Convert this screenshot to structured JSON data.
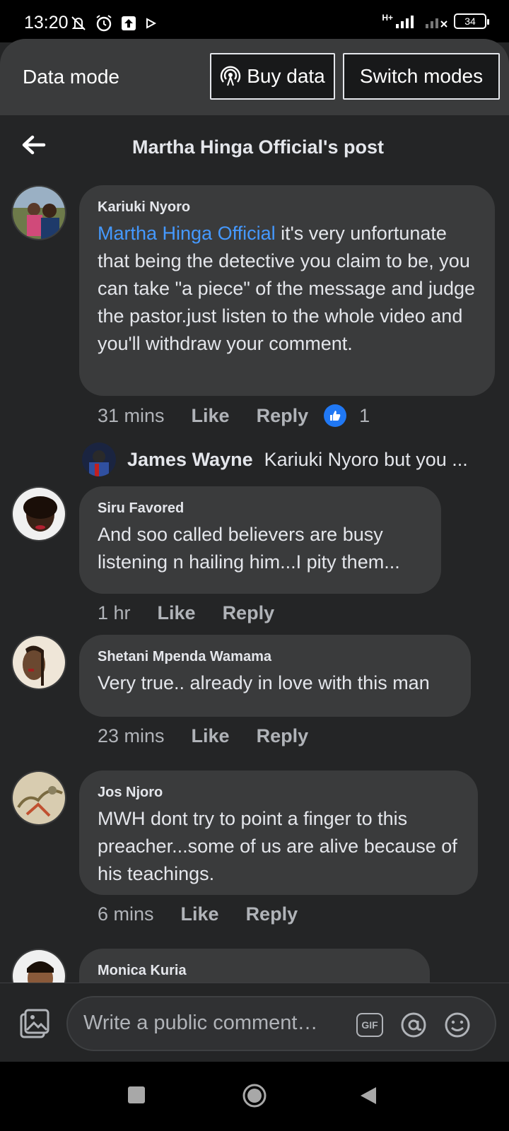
{
  "status_bar": {
    "time": "13:20",
    "battery": "34",
    "network": "H+"
  },
  "data_mode": {
    "title": "Data mode",
    "buy_label": "Buy data",
    "switch_label": "Switch modes"
  },
  "header": {
    "title": "Martha Hinga Official's post"
  },
  "comments": [
    {
      "author": "Kariuki Nyoro",
      "mention": "Martha Hinga Official",
      "text": " it's very unfortunate that being the detective you claim to be, you can take \"a piece\" of the message and judge the pastor.just listen to the whole video and you'll withdraw your comment.",
      "time": "31 mins",
      "like": "Like",
      "reply": "Reply",
      "reaction_count": "1"
    },
    {
      "author": "Siru Favored",
      "text": "And soo called believers are busy listening n hailing him...I pity them...",
      "time": "1 hr",
      "like": "Like",
      "reply": "Reply"
    },
    {
      "author": "Shetani Mpenda Wamama",
      "text": "Very true.. already in love with this man",
      "time": "23 mins",
      "like": "Like",
      "reply": "Reply"
    },
    {
      "author": "Jos Njoro",
      "text": "MWH dont try to point a finger to this preacher...some of us are alive because of his teachings.",
      "time": "6 mins",
      "like": "Like",
      "reply": "Reply"
    },
    {
      "author": "Monica Kuria"
    }
  ],
  "reply_preview": {
    "author": "James Wayne",
    "text": "Kariuki Nyoro but you ..."
  },
  "composer": {
    "placeholder": "Write a public comment…",
    "gif_label": "GIF"
  },
  "colors": {
    "background": "#242526",
    "bubble": "#3a3b3c",
    "link": "#4599ff",
    "like_badge": "#2078f4"
  }
}
